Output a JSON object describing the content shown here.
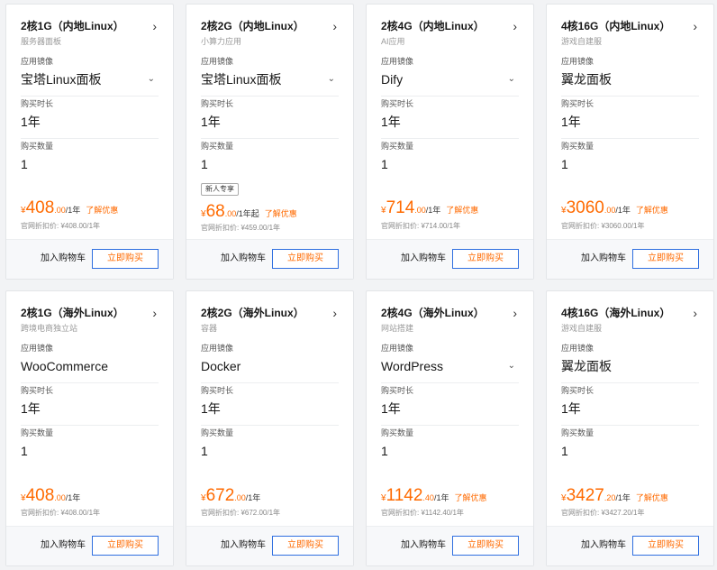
{
  "cards": [
    {
      "title": "2核1G（内地Linux）",
      "subtitle": "服务器面板",
      "image_label": "应用镜像",
      "image": "宝塔Linux面板",
      "duration_label": "购买时长",
      "duration": "1年",
      "qty_label": "购买数量",
      "qty": "1",
      "tag": "",
      "currency": "¥",
      "price_int": "408",
      "price_dec": ".00",
      "unit": "/1年",
      "deal": "了解优惠",
      "orig": "官网折扣价: ¥408.00/1年",
      "cart": "加入购物车",
      "buy": "立即购买"
    },
    {
      "title": "2核2G（内地Linux）",
      "subtitle": "小算力应用",
      "image_label": "应用镜像",
      "image": "宝塔Linux面板",
      "duration_label": "购买时长",
      "duration": "1年",
      "qty_label": "购买数量",
      "qty": "1",
      "tag": "新人专享",
      "currency": "¥",
      "price_int": "68",
      "price_dec": ".00",
      "unit": "/1年起",
      "deal": "了解优惠",
      "orig": "官网折扣价: ¥459.00/1年",
      "cart": "加入购物车",
      "buy": "立即购买"
    },
    {
      "title": "2核4G（内地Linux）",
      "subtitle": "AI应用",
      "image_label": "应用镜像",
      "image": "Dify",
      "duration_label": "购买时长",
      "duration": "1年",
      "qty_label": "购买数量",
      "qty": "1",
      "tag": "",
      "currency": "¥",
      "price_int": "714",
      "price_dec": ".00",
      "unit": "/1年",
      "deal": "了解优惠",
      "orig": "官网折扣价: ¥714.00/1年",
      "cart": "加入购物车",
      "buy": "立即购买"
    },
    {
      "title": "4核16G（内地Linux）",
      "subtitle": "游戏自建服",
      "image_label": "应用镜像",
      "image": "翼龙面板",
      "duration_label": "购买时长",
      "duration": "1年",
      "qty_label": "购买数量",
      "qty": "1",
      "tag": "",
      "currency": "¥",
      "price_int": "3060",
      "price_dec": ".00",
      "unit": "/1年",
      "deal": "了解优惠",
      "orig": "官网折扣价: ¥3060.00/1年",
      "cart": "加入购物车",
      "buy": "立即购买"
    },
    {
      "title": "2核1G（海外Linux）",
      "subtitle": "跨境电商独立站",
      "image_label": "应用镜像",
      "image": "WooCommerce",
      "duration_label": "购买时长",
      "duration": "1年",
      "qty_label": "购买数量",
      "qty": "1",
      "tag": "",
      "currency": "¥",
      "price_int": "408",
      "price_dec": ".00",
      "unit": "/1年",
      "deal": "",
      "orig": "官网折扣价: ¥408.00/1年",
      "cart": "加入购物车",
      "buy": "立即购买"
    },
    {
      "title": "2核2G（海外Linux）",
      "subtitle": "容器",
      "image_label": "应用镜像",
      "image": "Docker",
      "duration_label": "购买时长",
      "duration": "1年",
      "qty_label": "购买数量",
      "qty": "1",
      "tag": "",
      "currency": "¥",
      "price_int": "672",
      "price_dec": ".00",
      "unit": "/1年",
      "deal": "",
      "orig": "官网折扣价: ¥672.00/1年",
      "cart": "加入购物车",
      "buy": "立即购买"
    },
    {
      "title": "2核4G（海外Linux）",
      "subtitle": "网站搭建",
      "image_label": "应用镜像",
      "image": "WordPress",
      "duration_label": "购买时长",
      "duration": "1年",
      "qty_label": "购买数量",
      "qty": "1",
      "tag": "",
      "currency": "¥",
      "price_int": "1142",
      "price_dec": ".40",
      "unit": "/1年",
      "deal": "了解优惠",
      "orig": "官网折扣价: ¥1142.40/1年",
      "cart": "加入购物车",
      "buy": "立即购买"
    },
    {
      "title": "4核16G（海外Linux）",
      "subtitle": "游戏自建服",
      "image_label": "应用镜像",
      "image": "翼龙面板",
      "duration_label": "购买时长",
      "duration": "1年",
      "qty_label": "购买数量",
      "qty": "1",
      "tag": "",
      "currency": "¥",
      "price_int": "3427",
      "price_dec": ".20",
      "unit": "/1年",
      "deal": "了解优惠",
      "orig": "官网折扣价: ¥3427.20/1年",
      "cart": "加入购物车",
      "buy": "立即购买"
    }
  ],
  "icons": {
    "chevron_right": "›",
    "chevron_down": "⌄"
  },
  "colors": {
    "price": "#ff6a00",
    "buy_border": "#2f6fe0",
    "background": "#f2f3f5"
  }
}
